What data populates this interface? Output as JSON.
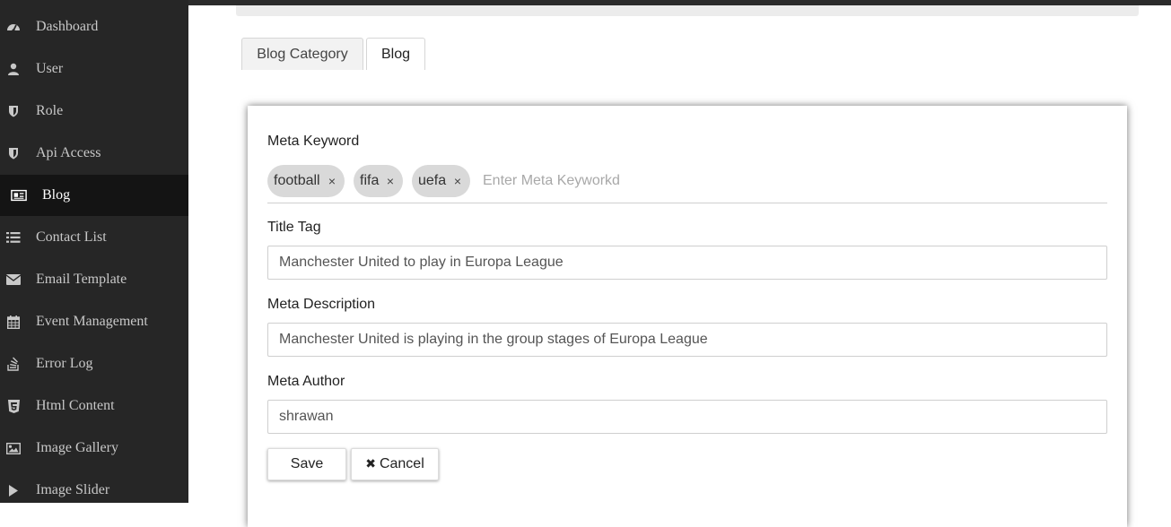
{
  "sidebar": {
    "items": [
      {
        "label": "Dashboard",
        "icon": "dashboard-icon"
      },
      {
        "label": "User",
        "icon": "user-icon"
      },
      {
        "label": "Role",
        "icon": "shield-icon"
      },
      {
        "label": "Api Access",
        "icon": "shield-icon"
      },
      {
        "label": "Blog",
        "icon": "newspaper-icon"
      },
      {
        "label": "Contact List",
        "icon": "list-icon"
      },
      {
        "label": "Email Template",
        "icon": "envelope-icon"
      },
      {
        "label": "Event Management",
        "icon": "calendar-icon"
      },
      {
        "label": "Error Log",
        "icon": "stack-overflow-icon"
      },
      {
        "label": "Html Content",
        "icon": "html5-icon"
      },
      {
        "label": "Image Gallery",
        "icon": "image-icon"
      },
      {
        "label": "Image Slider",
        "icon": "play-icon"
      }
    ],
    "active": "Blog"
  },
  "tabs": [
    {
      "label": "Blog Category"
    },
    {
      "label": "Blog"
    }
  ],
  "form": {
    "meta_keyword": {
      "label": "Meta Keyword",
      "chips": [
        "football",
        "fifa",
        "uefa"
      ],
      "remove_symbol": "×",
      "placeholder": "Enter Meta Keyworkd"
    },
    "title_tag": {
      "label": "Title Tag",
      "value": "Manchester United to play in Europa League"
    },
    "meta_description": {
      "label": "Meta Description",
      "value": "Manchester United is playing in the group stages of Europa League"
    },
    "meta_author": {
      "label": "Meta Author",
      "value": "shrawan"
    },
    "save_label": "Save",
    "cancel_label": "Cancel",
    "cancel_icon": "✖"
  },
  "colors": {
    "sidebar_bg": "#262626",
    "sidebar_active_bg": "#141414",
    "chip_bg": "#d9d9d9"
  }
}
